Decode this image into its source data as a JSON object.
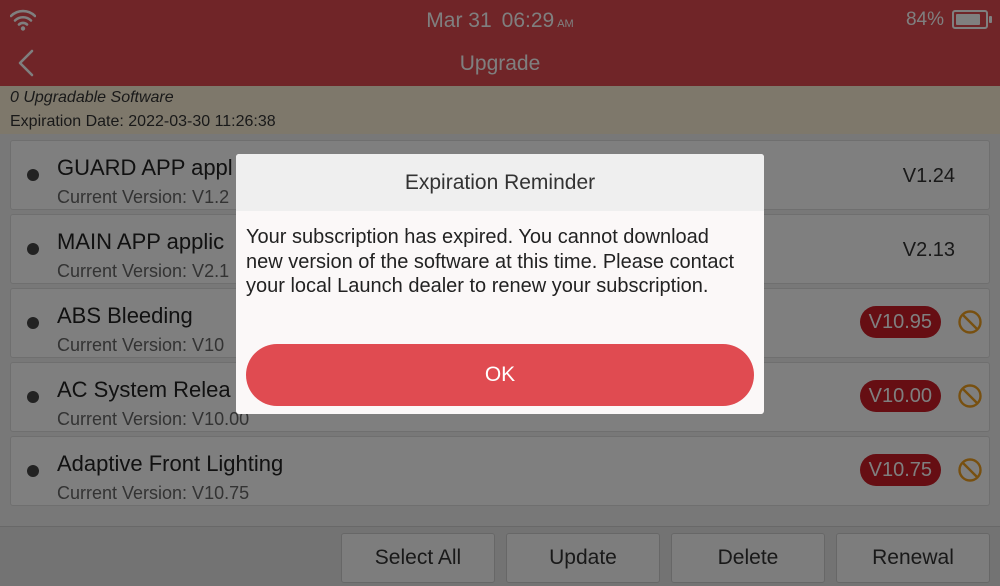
{
  "status_bar": {
    "date": "Mar 31",
    "time": "06:29",
    "ampm": "AM",
    "battery_text": "84%",
    "battery_level": 0.84
  },
  "header": {
    "title": "Upgrade"
  },
  "info": {
    "upgradable": "0 Upgradable Software",
    "expiration": "Expiration Date: 2022-03-30 11:26:38"
  },
  "list": {
    "items": [
      {
        "name": "GUARD APP appl",
        "current": "Current Version: V1.2",
        "version": "V1.24"
      },
      {
        "name": "MAIN APP applic",
        "current": "Current Version: V2.1",
        "version": "V2.13"
      },
      {
        "name": "ABS Bleeding",
        "current": "Current Version: V10",
        "version": "V10.95"
      },
      {
        "name": "AC System Relea",
        "current": "Current Version: V10.00",
        "version": "V10.00"
      },
      {
        "name": "Adaptive Front Lighting",
        "current": "Current Version: V10.75",
        "version": "V10.75"
      }
    ]
  },
  "footer": {
    "select_all": "Select All",
    "update": "Update",
    "delete": "Delete",
    "renewal": "Renewal"
  },
  "dialog": {
    "title": "Expiration Reminder",
    "message": "Your subscription has expired. You cannot download new version of the software at this time. Please contact your local Launch dealer to renew your subscription.",
    "ok": "OK"
  },
  "colors": {
    "accent": "#e04b51",
    "badge": "#cc1d27",
    "info_bg": "#fdf1d7",
    "ban_icon": "#f0a020"
  },
  "icons": {
    "wifi": "wifi-icon",
    "back": "back-arrow-icon",
    "battery": "battery-icon",
    "no_update": "no-entry-icon"
  }
}
